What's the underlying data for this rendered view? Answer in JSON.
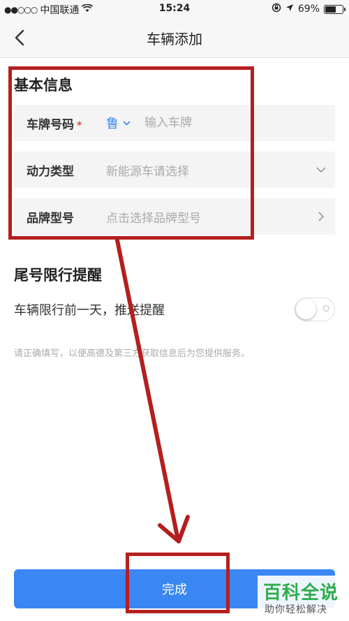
{
  "status_bar": {
    "signal_dots": "●●○○○",
    "carrier": "中国联通",
    "time": "15:24",
    "battery_text": "69%",
    "battery_level": 0.69
  },
  "header": {
    "title": "车辆添加"
  },
  "basic_info": {
    "title": "基本信息",
    "plate": {
      "label": "车牌号码",
      "required_mark": "*",
      "province": "鲁",
      "placeholder": "输入车牌"
    },
    "power_type": {
      "label": "动力类型",
      "value": "新能源车请选择"
    },
    "brand_model": {
      "label": "品牌型号",
      "value": "点击选择品牌型号"
    }
  },
  "reminder": {
    "title": "尾号限行提醒",
    "toggle_label": "车辆限行前一天，推送提醒",
    "toggle_on": false
  },
  "hint": "请正确填写，以便高德及第三方获取信息后为您提供服务。",
  "done_button": "完成",
  "watermark": {
    "title": "百科全说",
    "subtitle": "助你轻松解决"
  },
  "colors": {
    "accent": "#3a86f3",
    "annotation": "#b41f1f",
    "watermark": "#2eae4b"
  }
}
